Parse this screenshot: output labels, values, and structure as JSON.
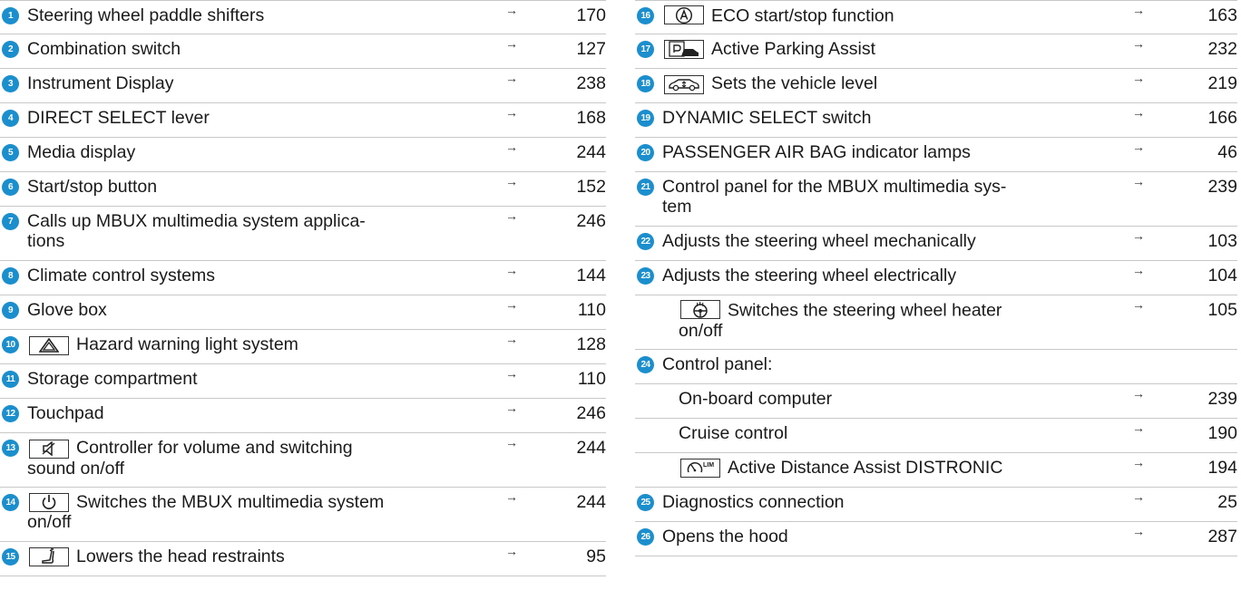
{
  "arrow_glyph": "→",
  "accent_color": "#1b8fce",
  "left_items": [
    {
      "num": "1",
      "line1": "Steering wheel paddle shifters",
      "page": "170"
    },
    {
      "num": "2",
      "line1": "Combination switch",
      "page": "127"
    },
    {
      "num": "3",
      "line1": "Instrument Display",
      "page": "238"
    },
    {
      "num": "4",
      "line1": "DIRECT SELECT lever",
      "page": "168"
    },
    {
      "num": "5",
      "line1": "Media display",
      "page": "244"
    },
    {
      "num": "6",
      "line1": "Start/stop button",
      "page": "152"
    },
    {
      "num": "7",
      "line1": "Calls up MBUX multimedia system applica-",
      "line2": "tions",
      "page": "246"
    },
    {
      "num": "8",
      "line1": "Climate control systems",
      "page": "144"
    },
    {
      "num": "9",
      "line1": "Glove box",
      "page": "110"
    },
    {
      "num": "10",
      "icon": "hazard-warning-icon",
      "line1": "Hazard warning light system",
      "page": "128"
    },
    {
      "num": "11",
      "line1": "Storage compartment",
      "page": "110"
    },
    {
      "num": "12",
      "line1": "Touchpad",
      "page": "246"
    },
    {
      "num": "13",
      "icon": "volume-mute-icon",
      "line1": "Controller for volume and switching",
      "line2": "sound on/off",
      "page": "244"
    },
    {
      "num": "14",
      "icon": "power-icon",
      "line1": "Switches the MBUX multimedia system",
      "line2": "on/off",
      "page": "244"
    },
    {
      "num": "15",
      "icon": "head-restraint-icon",
      "line1": "Lowers the head restraints",
      "page": "95"
    }
  ],
  "right_items": [
    {
      "num": "16",
      "icon": "eco-start-stop-icon",
      "line1": "ECO start/stop function",
      "page": "163"
    },
    {
      "num": "17",
      "icon": "parking-assist-icon",
      "line1": "Active Parking Assist",
      "page": "232"
    },
    {
      "num": "18",
      "icon": "vehicle-level-icon",
      "line1": "Sets the vehicle level",
      "page": "219"
    },
    {
      "num": "19",
      "line1": "DYNAMIC SELECT switch",
      "page": "166"
    },
    {
      "num": "20",
      "line1": "PASSENGER AIR BAG indicator lamps",
      "page": "46"
    },
    {
      "num": "21",
      "line1": "Control panel for the MBUX multimedia sys-",
      "line2": "tem",
      "page": "239"
    },
    {
      "num": "22",
      "line1": "Adjusts the steering wheel mechanically",
      "page": "103"
    },
    {
      "num": "23",
      "line1": "Adjusts the steering wheel electrically",
      "page": "104"
    },
    {
      "num": "",
      "icon": "steering-wheel-heater-icon",
      "line1": "Switches the steering wheel heater",
      "line2": "on/off",
      "page": "105"
    },
    {
      "num": "24",
      "line1": "Control panel:",
      "page": ""
    },
    {
      "num": "",
      "line1": "On-board computer",
      "page": "239"
    },
    {
      "num": "",
      "line1": "Cruise control",
      "page": "190"
    },
    {
      "num": "",
      "icon": "distronic-icon",
      "icon_text": "LIM",
      "line1": "Active Distance Assist DISTRONIC",
      "page": "194"
    },
    {
      "num": "25",
      "line1": "Diagnostics connection",
      "page": "25"
    },
    {
      "num": "26",
      "line1": "Opens the hood",
      "page": "287"
    }
  ]
}
